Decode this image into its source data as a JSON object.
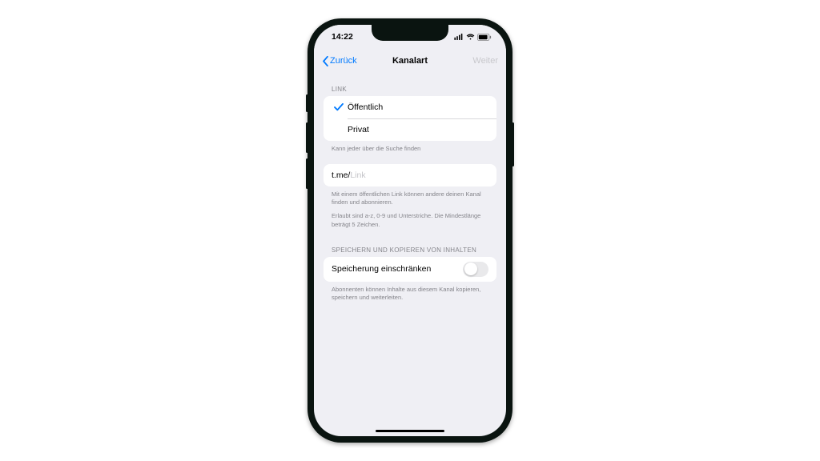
{
  "status": {
    "time": "14:22"
  },
  "nav": {
    "back": "Zurück",
    "title": "Kanalart",
    "next": "Weiter"
  },
  "link_section": {
    "header": "LINK",
    "options": {
      "public": "Öffentlich",
      "private": "Privat"
    },
    "footer": "Kann jeder über die Suche finden"
  },
  "link_input": {
    "prefix": "t.me/",
    "placeholder": "Link",
    "footer1": "Mit einem öffentlichen Link können andere deinen Kanal finden und abonnieren.",
    "footer2": "Erlaubt sind a-z, 0-9 und Unterstriche. Die Mindestlänge beträgt 5 Zeichen."
  },
  "save_section": {
    "header": "SPEICHERN UND KOPIEREN VON INHALTEN",
    "toggle_label": "Speicherung einschränken",
    "footer": "Abonnenten können Inhalte aus diesem Kanal kopieren, speichern und weiterleiten."
  }
}
